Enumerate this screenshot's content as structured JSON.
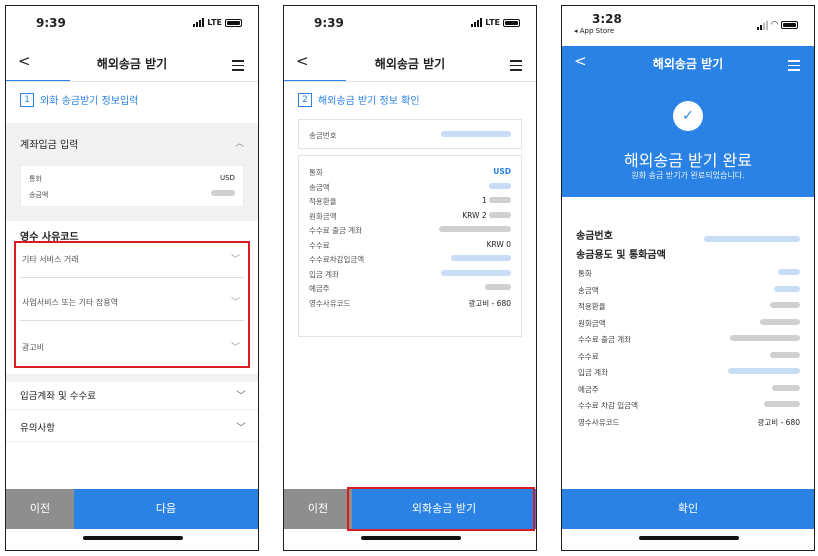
{
  "p1": {
    "time": "9:39",
    "network": "LTE",
    "title": "해외송금 받기",
    "step_num": "1",
    "step_label": "외화 송금받기 정보입력",
    "section1_title": "계좌입금 입력",
    "rows": [
      {
        "label": "통화",
        "value": "USD"
      },
      {
        "label": "송금액",
        "value": ""
      }
    ],
    "receipt_title": "영수 사유코드",
    "selects": [
      "기타 서비스 거래",
      "사업서비스 또는 기타 잡용역",
      "광고비"
    ],
    "acc1": "입금계좌 및 수수료",
    "acc2": "유의사항",
    "btn_prev": "이전",
    "btn_next": "다음"
  },
  "p2": {
    "time": "9:39",
    "network": "LTE",
    "title": "해외송금 받기",
    "step_num": "2",
    "step_label": "해외송금 받기 정보 확인",
    "ref_label": "송금번호",
    "rows": [
      {
        "label": "통화",
        "value": "USD"
      },
      {
        "label": "송금액",
        "value": ""
      },
      {
        "label": "적용환율",
        "value": "1"
      },
      {
        "label": "원화금액",
        "value": "KRW 2"
      },
      {
        "label": "수수료 출금 계좌",
        "value": ""
      },
      {
        "label": "수수료",
        "value": "KRW 0"
      },
      {
        "label": "수수료차감입금액",
        "value": ""
      },
      {
        "label": "입금 계좌",
        "value": ""
      },
      {
        "label": "예금주",
        "value": ""
      },
      {
        "label": "영수사유코드",
        "value": "광고비 - 680"
      }
    ],
    "btn_prev": "이전",
    "btn_next": "외화송금 받기"
  },
  "p3": {
    "time": "3:28",
    "back_app": "◂ App Store",
    "title": "해외송금 받기",
    "done_title": "해외송금 받기 완료",
    "done_sub": "원화 송금 받기가 완료되었습니다.",
    "ref_label": "송금번호",
    "purpose_label": "송금용도 및 통화금액",
    "rows": [
      {
        "label": "통화",
        "value": ""
      },
      {
        "label": "송금액",
        "value": ""
      },
      {
        "label": "적용환율",
        "value": ""
      },
      {
        "label": "원화금액",
        "value": ""
      },
      {
        "label": "수수료 출금 계좌",
        "value": ""
      },
      {
        "label": "수수료",
        "value": ""
      },
      {
        "label": "입금 계좌",
        "value": ""
      },
      {
        "label": "예금주",
        "value": ""
      },
      {
        "label": "수수료 차감 입금액",
        "value": ""
      },
      {
        "label": "영수사유코드",
        "value": "광고비 - 680"
      }
    ],
    "btn_confirm": "확인"
  },
  "colors": {
    "accent": "#2a82e4",
    "highlight": "#d71c23",
    "secondary_button": "#8e8e8e"
  }
}
